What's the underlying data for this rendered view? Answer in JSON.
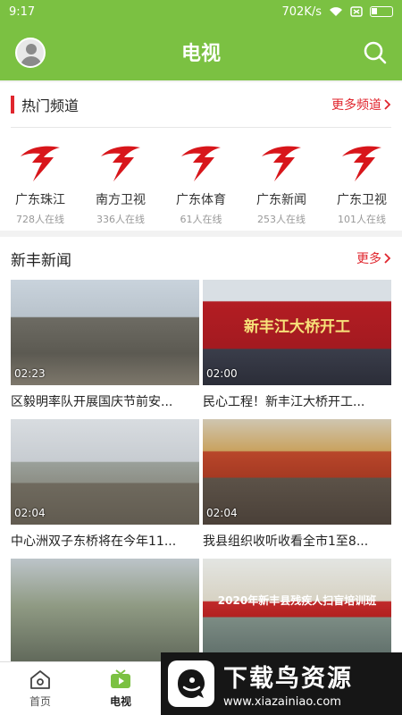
{
  "status_bar": {
    "time": "9:17",
    "speed": "702K/s"
  },
  "header": {
    "title": "电视"
  },
  "hot_channels": {
    "title": "热门频道",
    "more": "更多频道",
    "items": [
      {
        "name": "广东珠江",
        "count": "728人在线"
      },
      {
        "name": "南方卫视",
        "count": "336人在线"
      },
      {
        "name": "广东体育",
        "count": "61人在线"
      },
      {
        "name": "广东新闻",
        "count": "253人在线"
      },
      {
        "name": "广东卫视",
        "count": "101人在线"
      }
    ]
  },
  "news": {
    "title": "新丰新闻",
    "more": "更多",
    "items": [
      {
        "title": "区毅明率队开展国庆节前安...",
        "duration": "02:23"
      },
      {
        "title": "民心工程！新丰江大桥开工...",
        "duration": "02:00",
        "overlay": "新丰江大桥开工"
      },
      {
        "title": "中心洲双子东桥将在今年11...",
        "duration": "02:04"
      },
      {
        "title": "我县组织收听收看全市1至8...",
        "duration": "02:04"
      },
      {
        "title": "",
        "duration": ""
      },
      {
        "title": "",
        "duration": "",
        "overlay": "2020年新丰县残疾人扫盲培训班"
      }
    ]
  },
  "bottom_nav": {
    "home": "首页",
    "tv": "电视"
  },
  "watermark": {
    "name": "下载鸟资源",
    "url": "www.xiazainiao.com"
  },
  "colors": {
    "primary": "#7bc142",
    "accent": "#e0262e"
  }
}
